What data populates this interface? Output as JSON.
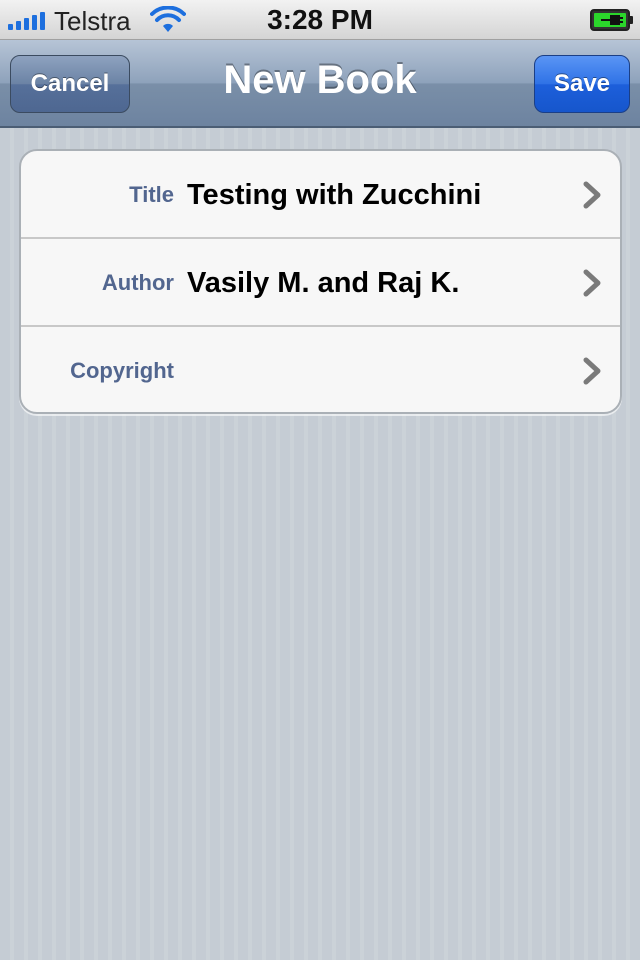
{
  "status_bar": {
    "carrier": "Telstra",
    "time": "3:28 PM",
    "signal_bars": 5,
    "wifi_icon": "wifi-icon",
    "battery_icon": "battery-charging-icon",
    "battery_color": "#2bd62b"
  },
  "nav_bar": {
    "title": "New Book",
    "cancel_label": "Cancel",
    "save_label": "Save",
    "save_color": "#2f72e6"
  },
  "form": {
    "rows": [
      {
        "label": "Title",
        "value": "Testing with Zucchini",
        "icon": "chevron-right-icon"
      },
      {
        "label": "Author",
        "value": "Vasily M. and Raj K.",
        "icon": "chevron-right-icon"
      },
      {
        "label": "Copyright",
        "value": "",
        "icon": "chevron-right-icon"
      }
    ]
  },
  "colors": {
    "label_color": "#52668f",
    "background": "#c5ccd4"
  }
}
